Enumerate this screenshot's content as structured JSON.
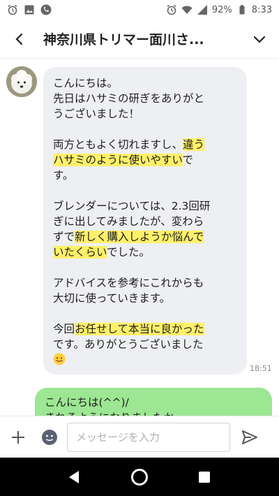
{
  "status_bar": {
    "battery": "92%",
    "time": "8:33",
    "icons": [
      "alarm-icon",
      "image-icon",
      "phone-icon",
      "alarm-icon",
      "wifi-icon",
      "signal-icon",
      "battery-icon"
    ]
  },
  "header": {
    "title": "神奈川県トリマー面川さ...",
    "back_icon": "back-arrow-icon",
    "menu_icon": "chevron-down-icon"
  },
  "messages": {
    "incoming": {
      "line_01": "こんにちは。",
      "line_02": "先日はハサミの研ぎをありがと",
      "line_03": "うございました！",
      "line_04_a": "両方ともよく切れますし、",
      "line_04_b": "違う",
      "line_05_a": "ハサミのように使いやすい",
      "line_05_b": "で",
      "line_06": "す。",
      "line_07": "ブレンダーについては、2.3回研",
      "line_08": "ぎに出してみましたが、変わら",
      "line_09_a": "ずで",
      "line_09_b": "新しく購入しようか悩んで",
      "line_10_a": "いたくらい",
      "line_10_b": "でした。",
      "line_11": "アドバイスを参考にこれからも",
      "line_12": "大切に使っていきます。",
      "line_13_a": "今回",
      "line_13_b": "お任せして本当に良かった",
      "line_14": "です。ありがとうございました",
      "time": "18:51"
    },
    "outgoing": {
      "line_1": "こんにちは(^^)/",
      "line_2": "きれるようになりましたか~"
    }
  },
  "input_bar": {
    "placeholder": "メッセージを入力"
  },
  "colors": {
    "incoming_bubble": "#eeeff2",
    "outgoing_bubble": "#9de693",
    "highlight": "#fff06a"
  }
}
